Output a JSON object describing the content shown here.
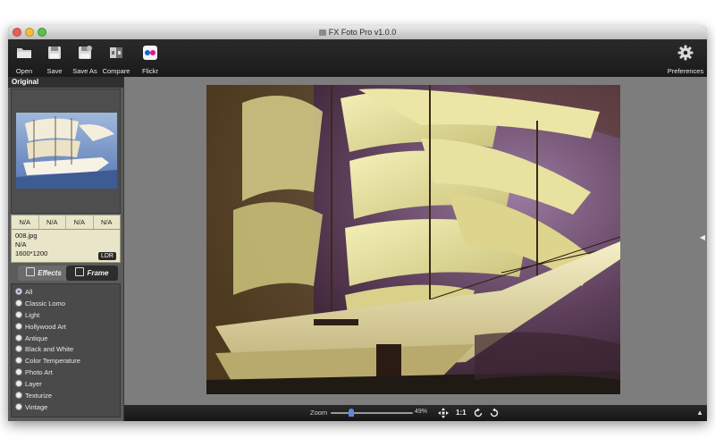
{
  "window": {
    "title": "FX Foto Pro v1.0.0"
  },
  "toolbar": {
    "open": "Open",
    "save": "Save",
    "save_as": "Save As",
    "compare": "Compare",
    "flickr": "Flickr",
    "preferences": "Preferences"
  },
  "sidebar": {
    "header": "Original",
    "histogram": [
      "N/A",
      "N/A",
      "N/A",
      "N/A"
    ],
    "file_name": "008.jpg",
    "file_info": "N/A",
    "dimensions": "1600*1200",
    "badge": "LDR",
    "tabs": {
      "effects": "Effects",
      "frame": "Frame"
    },
    "effects": [
      {
        "label": "All",
        "selected": true
      },
      {
        "label": "Classic Lomo",
        "selected": false
      },
      {
        "label": "Light",
        "selected": false
      },
      {
        "label": "Hollywood Art",
        "selected": false
      },
      {
        "label": "Antique",
        "selected": false
      },
      {
        "label": "Black and White",
        "selected": false
      },
      {
        "label": "Color Temperature",
        "selected": false
      },
      {
        "label": "Photo Art",
        "selected": false
      },
      {
        "label": "Layer",
        "selected": false
      },
      {
        "label": "Texturize",
        "selected": false
      },
      {
        "label": "Vintage",
        "selected": false
      }
    ]
  },
  "statusbar": {
    "zoom_label": "Zoom",
    "zoom_value": "49%",
    "zoom_level": 0.49,
    "actual_size": "1:1"
  },
  "colors": {
    "toolbar_bg": "#1f1f1f",
    "canvas_bg": "#7d7d7d",
    "info_panel_bg": "#e9e5c8",
    "accent": "#5a8ad8"
  }
}
